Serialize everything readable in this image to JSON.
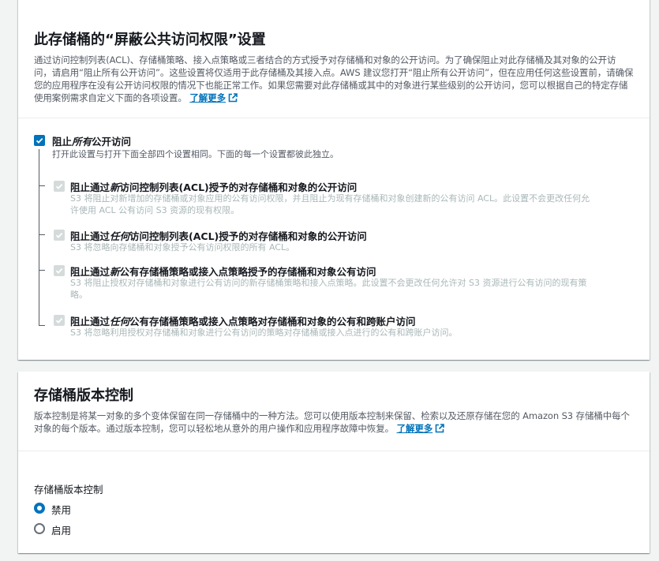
{
  "block_public_access": {
    "title": "此存储桶的“屏蔽公共访问权限”设置",
    "description": "通过访问控制列表(ACL)、存储桶策略、接入点策略或三者结合的方式授予对存储桶和对象的公开访问。为了确保阻止对此存储桶及其对象的公开访问，请启用“阻止所有公开访问”。这些设置将仅适用于此存储桶及其接入点。AWS 建议您打开“阻止所有公开访问”，但在应用任何这些设置前，请确保您的应用程序在没有公开访问权限的情况下也能正常工作。如果您需要对此存储桶或其中的对象进行某些级别的公开访问，您可以根据自己的特定存储使用案例需求自定义下面的各项设置。",
    "learn_more": "了解更多",
    "block_all": {
      "label_prefix": "阻止",
      "label_emph": "所有",
      "label_suffix": "公开访问",
      "description": "打开此设置与打开下面全部四个设置相同。下面的每一个设置都彼此独立。",
      "checked": true
    },
    "options": [
      {
        "label_prefix": "阻止通过",
        "label_emph": "新",
        "label_suffix": "访问控制列表(ACL)授予的对存储桶和对象的公开访问",
        "description_line1": "S3 将阻止对新增加的存储桶或对象应用的公有访问权限，并且阻止为现有存储桶和对象创建新的公有访问 ACL。此设置不会更改任何允",
        "description_line2": "许使用 ACL 公有访问 S3 资源的现有权限。",
        "checked": true
      },
      {
        "label_prefix": "阻止通过",
        "label_emph": "任何",
        "label_suffix": "访问控制列表(ACL)授予的对存储桶和对象的公开访问",
        "description_line1": "S3 将忽略向存储桶和对象授予公有访问权限的所有 ACL。",
        "description_line2": "",
        "checked": true
      },
      {
        "label_prefix": "阻止通过",
        "label_emph": "新",
        "label_suffix": "公有存储桶策略或接入点策略授予的存储桶和对象公有访问",
        "description_line1": "S3 将阻止授权对存储桶和对象进行公有访问的新存储桶策略和接入点策略。此设置不会更改任何允许对 S3 资源进行公有访问的现有策",
        "description_line2": "略。",
        "checked": true
      },
      {
        "label_prefix": "阻止通过",
        "label_emph": "任何",
        "label_suffix": "公有存储桶策略或接入点策略对存储桶和对象的公有和跨账户访问",
        "description_line1": "S3 将忽略利用授权对存储桶和对象进行公有访问的策略对存储桶或接入点进行的公有和跨账户访问。",
        "description_line2": "",
        "checked": true
      }
    ]
  },
  "versioning": {
    "title": "存储桶版本控制",
    "description": "版本控制是将某一对象的多个变体保留在同一存储桶中的一种方法。您可以使用版本控制来保留、检索以及还原存储在您的 Amazon S3 存储桶中每个对象的每个版本。通过版本控制，您可以轻松地从意外的用户操作和应用程序故障中恢复。",
    "learn_more": "了解更多",
    "field_label": "存储桶版本控制",
    "options": [
      {
        "label": "禁用",
        "selected": true
      },
      {
        "label": "启用",
        "selected": false
      }
    ]
  },
  "colors": {
    "accent": "#0073bb",
    "disabled": "#d5dbdb",
    "background": "#f2f3f3"
  },
  "icons": {
    "external_link": "external-link-icon",
    "check": "check-icon"
  }
}
